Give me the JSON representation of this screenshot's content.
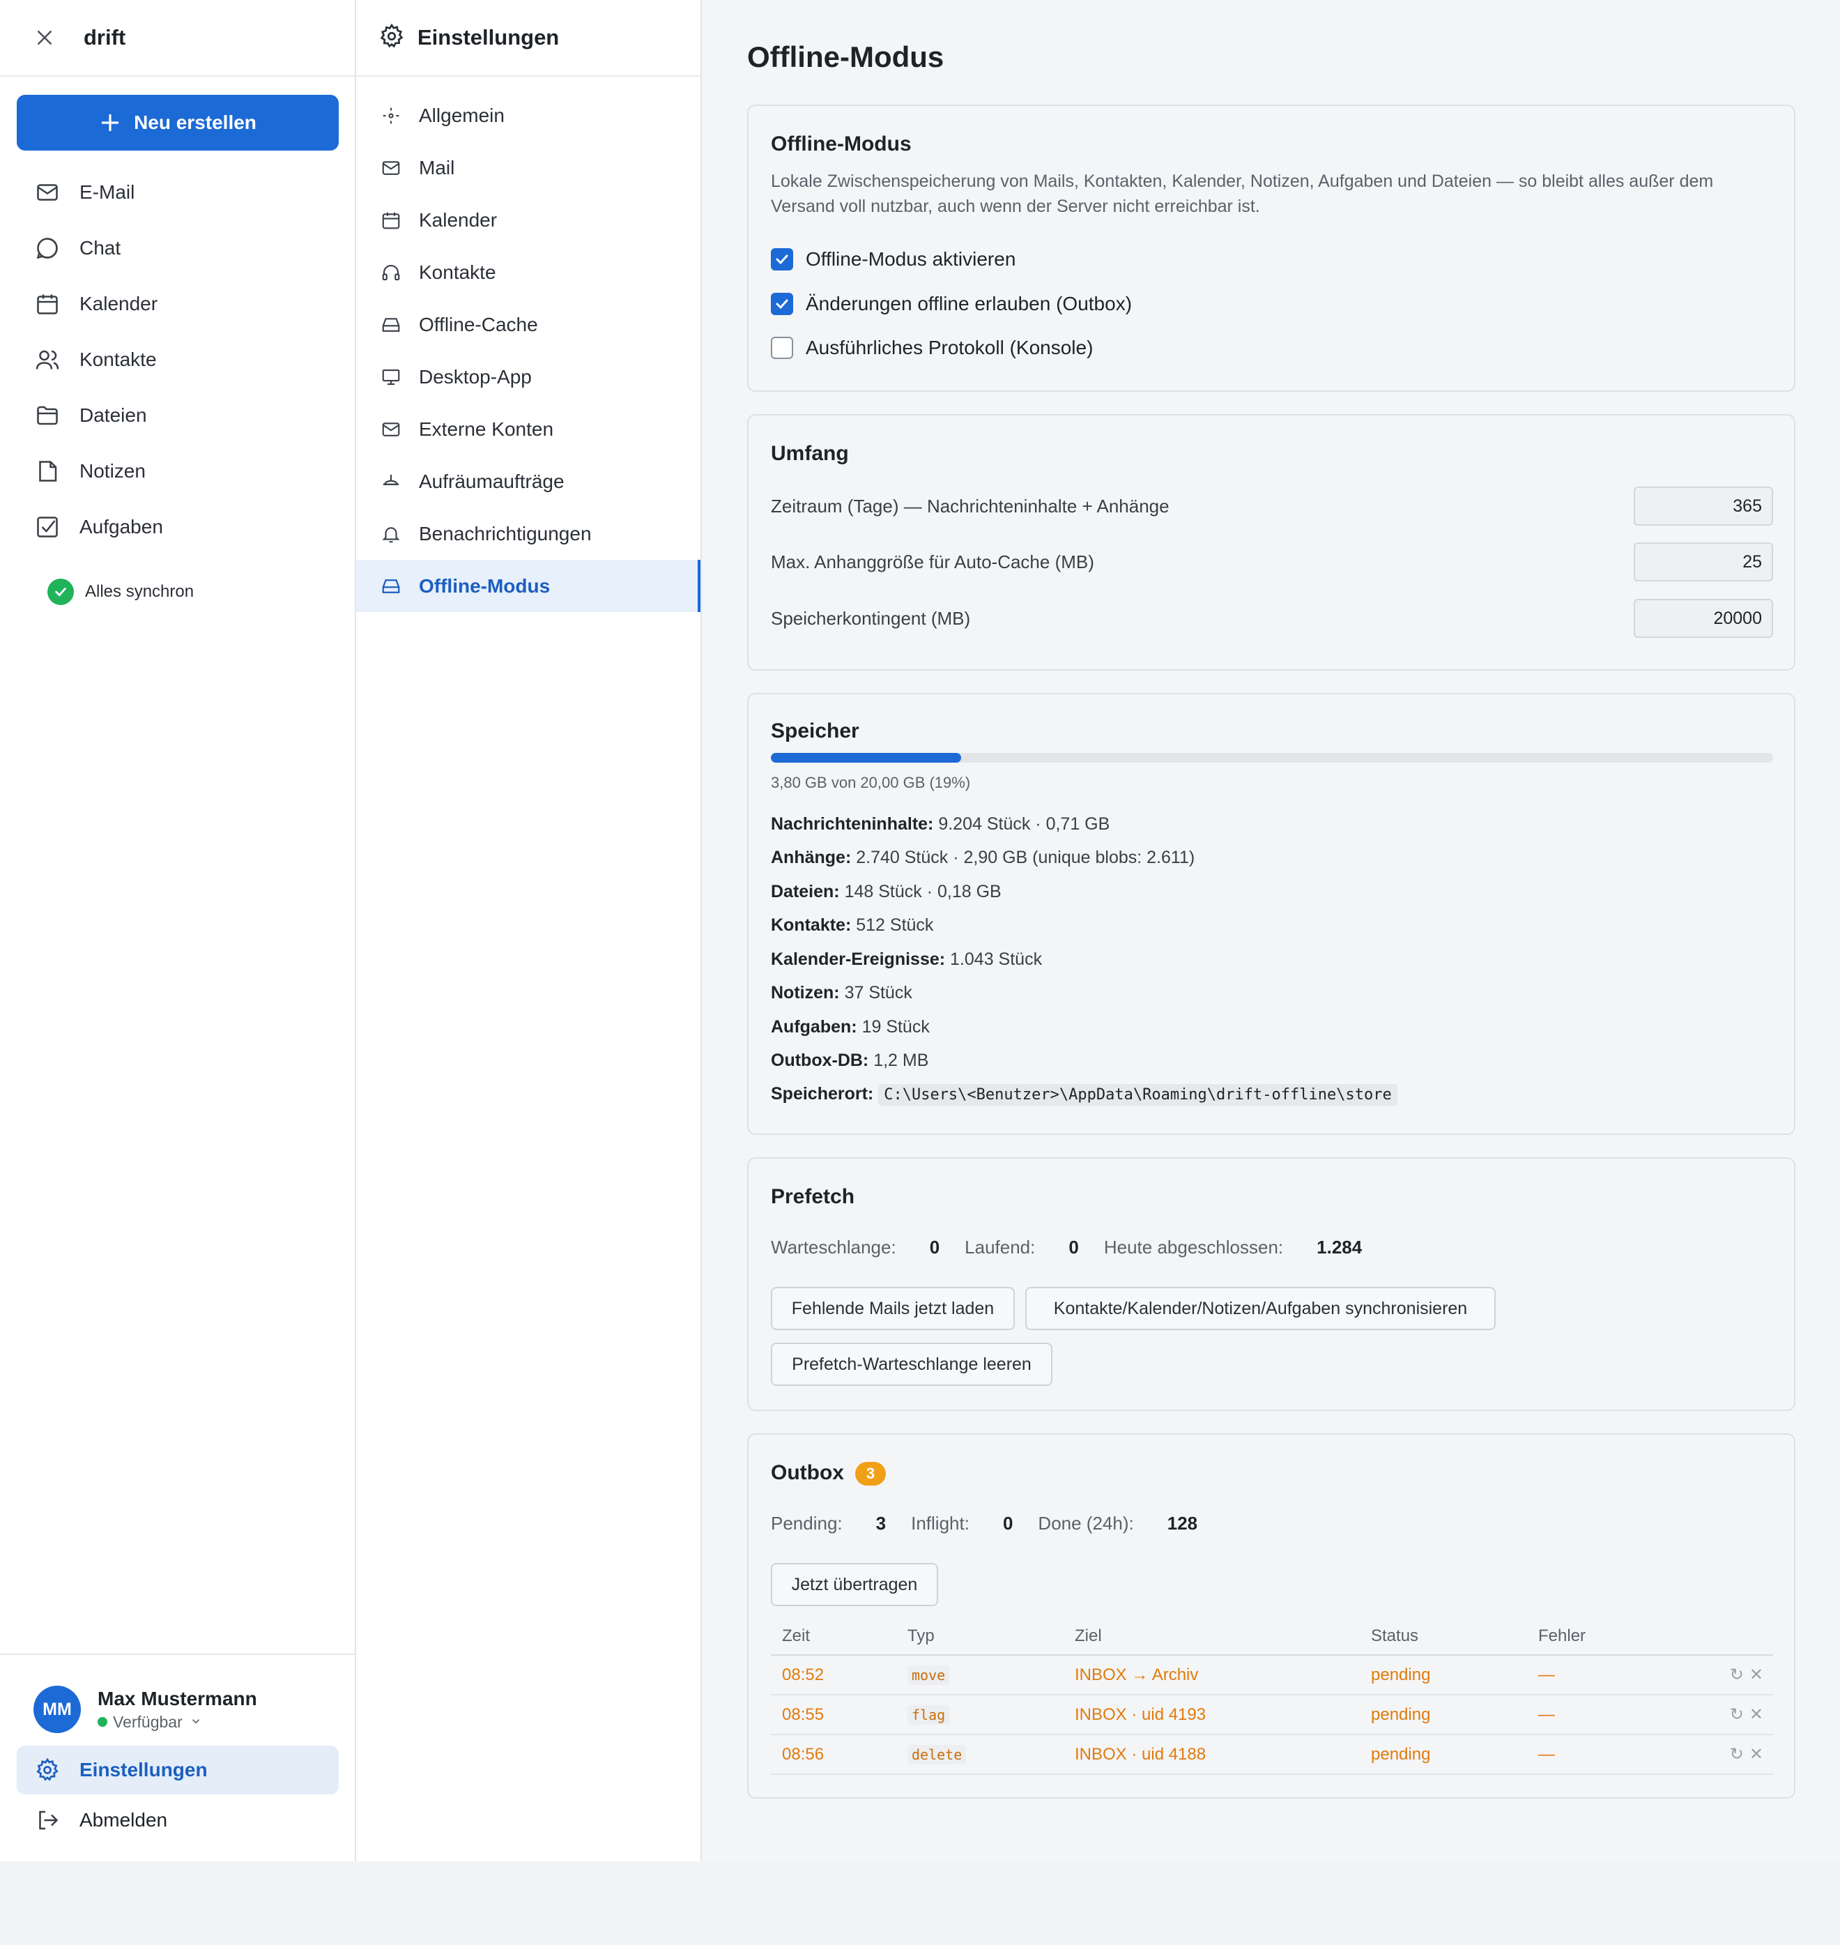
{
  "app": {
    "name": "drift"
  },
  "sidebar": {
    "new_button": "Neu erstellen",
    "items": [
      {
        "label": "E-Mail",
        "icon": "mail-icon"
      },
      {
        "label": "Chat",
        "icon": "chat-icon"
      },
      {
        "label": "Kalender",
        "icon": "calendar-icon"
      },
      {
        "label": "Kontakte",
        "icon": "users-icon"
      },
      {
        "label": "Dateien",
        "icon": "folder-icon"
      },
      {
        "label": "Notizen",
        "icon": "note-icon"
      },
      {
        "label": "Aufgaben",
        "icon": "checkbox-icon"
      }
    ],
    "sync_status": "Alles synchron",
    "user": {
      "initials": "MM",
      "name": "Max Mustermann",
      "status": "Verfügbar"
    },
    "settings_label": "Einstellungen",
    "logout_label": "Abmelden"
  },
  "settings_nav": {
    "title": "Einstellungen",
    "items": [
      {
        "label": "Allgemein",
        "icon": "sparkle-icon"
      },
      {
        "label": "Mail",
        "icon": "mail-icon"
      },
      {
        "label": "Kalender",
        "icon": "calendar-icon"
      },
      {
        "label": "Kontakte",
        "icon": "headset-icon"
      },
      {
        "label": "Offline-Cache",
        "icon": "drive-icon"
      },
      {
        "label": "Desktop-App",
        "icon": "monitor-icon"
      },
      {
        "label": "Externe Konten",
        "icon": "mail-icon"
      },
      {
        "label": "Aufräumaufträge",
        "icon": "broom-icon"
      },
      {
        "label": "Benachrichtigungen",
        "icon": "bell-icon"
      },
      {
        "label": "Offline-Modus",
        "icon": "drive-icon",
        "active": true
      }
    ]
  },
  "main": {
    "page_title": "Offline-Modus",
    "offline": {
      "title": "Offline-Modus",
      "description": "Lokale Zwischenspeicherung von Mails, Kontakten, Kalender, Notizen, Aufgaben und Dateien — so bleibt alles außer dem Versand voll nutzbar, auch wenn der Server nicht erreichbar ist.",
      "options": [
        {
          "label": "Offline-Modus aktivieren",
          "checked": true
        },
        {
          "label": "Änderungen offline erlauben (Outbox)",
          "checked": true
        },
        {
          "label": "Ausführliches Protokoll (Konsole)",
          "checked": false
        }
      ]
    },
    "scope": {
      "title": "Umfang",
      "fields": [
        {
          "label": "Zeitraum (Tage) — Nachrichteninhalte + Anhänge",
          "value": "365"
        },
        {
          "label": "Max. Anhanggröße für Auto-Cache (MB)",
          "value": "25"
        },
        {
          "label": "Speicherkontingent (MB)",
          "value": "20000"
        }
      ]
    },
    "storage": {
      "title": "Speicher",
      "usage_fraction": 0.19,
      "caption": "3,80 GB von 20,00 GB (19%)",
      "stats": [
        {
          "label": "Nachrichteninhalte:",
          "value": "9.204 Stück · 0,71 GB"
        },
        {
          "label": "Anhänge:",
          "value": "2.740 Stück · 2,90 GB (unique blobs: 2.611)"
        },
        {
          "label": "Dateien:",
          "value": "148 Stück · 0,18 GB"
        },
        {
          "label": "Kontakte:",
          "value": "512 Stück"
        },
        {
          "label": "Kalender-Ereignisse:",
          "value": "1.043 Stück"
        },
        {
          "label": "Notizen:",
          "value": "37 Stück"
        },
        {
          "label": "Aufgaben:",
          "value": "19 Stück"
        },
        {
          "label": "Outbox-DB:",
          "value": "1,2 MB"
        }
      ],
      "location_label": "Speicherort:",
      "location": "C:\\Users\\<Benutzer>\\AppData\\Roaming\\drift-offline\\store"
    },
    "prefetch": {
      "title": "Prefetch",
      "queue_label": "Warteschlange:",
      "queue": "0",
      "running_label": "Laufend:",
      "running": "0",
      "done_label": "Heute abgeschlossen:",
      "done": "1.284",
      "btn_load": "Fehlende Mails jetzt laden",
      "btn_sync": "Kontakte/Kalender/Notizen/Aufgaben synchronisieren",
      "btn_clear": "Prefetch-Warteschlange leeren"
    },
    "outbox": {
      "title": "Outbox",
      "badge": "3",
      "pending_label": "Pending:",
      "pending": "3",
      "inflight_label": "Inflight:",
      "inflight": "0",
      "done_label": "Done (24h):",
      "done": "128",
      "btn_send": "Jetzt übertragen",
      "columns": [
        "Zeit",
        "Typ",
        "Ziel",
        "Status",
        "Fehler"
      ],
      "rows": [
        {
          "time": "08:52",
          "type": "move",
          "target": "INBOX → Archiv",
          "status": "pending",
          "error": "—"
        },
        {
          "time": "08:55",
          "type": "flag",
          "target": "INBOX · uid 4193",
          "status": "pending",
          "error": "—"
        },
        {
          "time": "08:56",
          "type": "delete",
          "target": "INBOX · uid 4188",
          "status": "pending",
          "error": "—"
        }
      ]
    }
  }
}
